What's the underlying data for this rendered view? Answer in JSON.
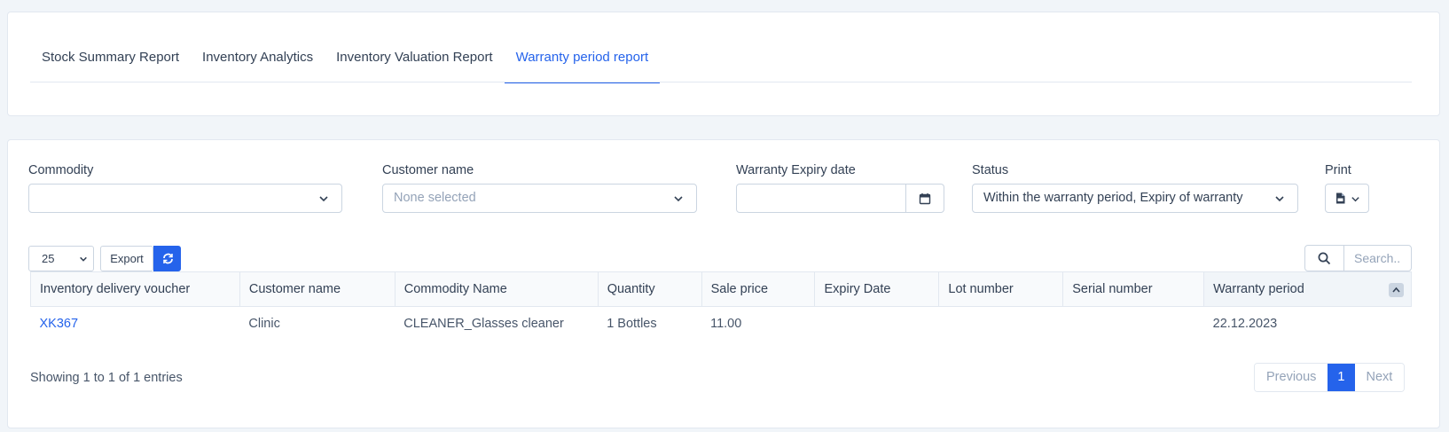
{
  "tabs": [
    {
      "label": "Stock Summary Report"
    },
    {
      "label": "Inventory Analytics"
    },
    {
      "label": "Inventory Valuation Report"
    },
    {
      "label": "Warranty period report"
    }
  ],
  "active_tab": "Warranty period report",
  "filters": {
    "commodity": {
      "label": "Commodity",
      "value": ""
    },
    "customer": {
      "label": "Customer name",
      "placeholder": "None selected"
    },
    "expiry": {
      "label": "Warranty Expiry date",
      "value": ""
    },
    "status": {
      "label": "Status",
      "value": "Within the warranty period, Expiry of warranty"
    },
    "print": {
      "label": "Print"
    }
  },
  "controls": {
    "page_size": "25",
    "export_label": "Export",
    "search_placeholder": "Search.."
  },
  "table": {
    "columns": [
      "Inventory delivery voucher",
      "Customer name",
      "Commodity Name",
      "Quantity",
      "Sale price",
      "Expiry Date",
      "Lot number",
      "Serial number",
      "Warranty period"
    ],
    "rows": [
      {
        "voucher": "XK367",
        "customer": "Clinic",
        "commodity": "CLEANER_Glasses cleaner",
        "quantity": "1 Bottles",
        "sale_price": "11.00",
        "expiry_date": "",
        "lot_number": "",
        "serial_number": "",
        "warranty_period": "22.12.2023"
      }
    ]
  },
  "footer": {
    "showing": "Showing 1 to 1 of 1 entries",
    "previous": "Previous",
    "page": "1",
    "next": "Next"
  },
  "colors": {
    "accent": "#2563eb",
    "border": "#cbd5e1",
    "background": "#f1f5f9"
  }
}
